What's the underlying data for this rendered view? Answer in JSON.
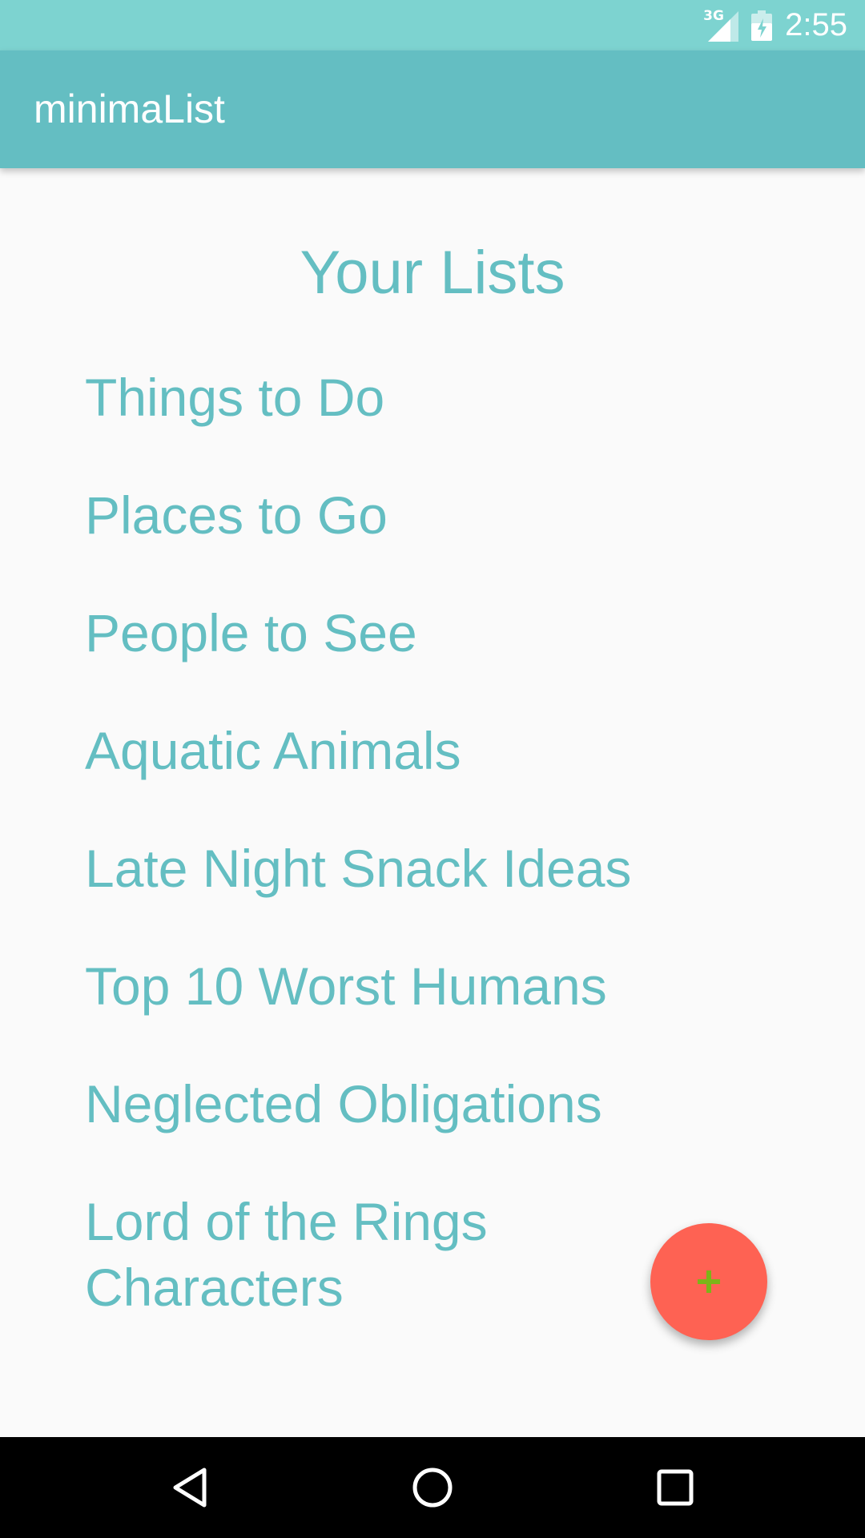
{
  "status_bar": {
    "network": "3G",
    "time": "2:55",
    "icons": [
      "signal-icon",
      "battery-icon"
    ]
  },
  "app_bar": {
    "title": "minimaList"
  },
  "main": {
    "heading": "Your Lists",
    "lists": [
      "Things to Do",
      "Places to Go",
      "People to See",
      "Aquatic Animals",
      "Late Night Snack Ideas",
      "Top 10 Worst Humans",
      "Neglected Obligations",
      "Lord of the Rings Characters"
    ]
  },
  "fab": {
    "icon": "plus-icon",
    "color": "#fe6253",
    "icon_color": "#7cb518"
  },
  "nav_bar": {
    "icons": [
      "back-icon",
      "home-icon",
      "recents-icon"
    ]
  },
  "colors": {
    "status_bar": "#7dd3d0",
    "app_bar": "#64bec2",
    "accent_text": "#64bec2",
    "background": "#fafafa"
  }
}
